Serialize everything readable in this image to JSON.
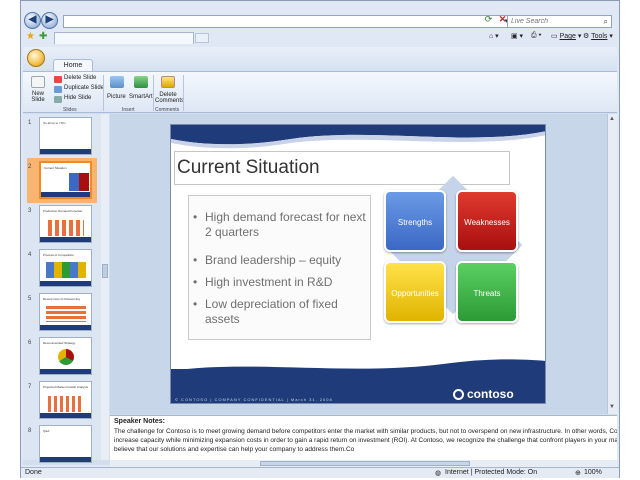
{
  "browser": {
    "search_placeholder": "Live Search",
    "commands": {
      "page": "Page",
      "tools": "Tools"
    }
  },
  "ribbon": {
    "tab_home": "Home",
    "new_slide": "New Slide",
    "delete_slide": "Delete Slide",
    "duplicate_slide": "Duplicate Slide",
    "hide_slide": "Hide Slide",
    "group_slides": "Slides",
    "picture": "Picture",
    "smartart": "SmartArt",
    "group_insert": "Insert",
    "delete_comments": "Delete Comments",
    "group_comments": "Comments"
  },
  "thumbnails": [
    {
      "num": "1",
      "title": "It's all up to YOU"
    },
    {
      "num": "2",
      "title": "Current Situation"
    },
    {
      "num": "3",
      "title": "Production Demand Forecast"
    },
    {
      "num": "4",
      "title": "Process of Competition"
    },
    {
      "num": "5",
      "title": "Recent Cost of Outsourcing"
    },
    {
      "num": "6",
      "title": "Recommended Strategy"
    },
    {
      "num": "7",
      "title": "Projected Market Growth Analysis"
    },
    {
      "num": "8",
      "title": "Q&A"
    }
  ],
  "slide": {
    "title": "Current Situation",
    "bullets": [
      "High demand forecast for next 2 quarters",
      "Brand leadership – equity",
      "High investment in R&D",
      "Low depreciation of fixed assets"
    ],
    "swot": {
      "strengths": "Strengths",
      "weaknesses": "Weaknesses",
      "opportunities": "Opportunities",
      "threats": "Threats"
    },
    "footer": "© CONTOSO  |  COMPANY CONFIDENTIAL  |  March 31, 2008",
    "logo": "contoso"
  },
  "notes": {
    "title": "Speaker Notes:",
    "body": "The challenge for Contoso is to meet growing demand before competitors enter the market with similar products, but not to overspend on new infrastructure. In other words, Contoso must increase capacity while minimizing expansion costs in order to gain a rapid return on investment (ROI). At Contoso, we recognize the challenge that confront players in your market and believe that our solutions and expertise can help your company to address them.Co"
  },
  "status": {
    "left": "Done",
    "zone": "Internet | Protected Mode: On",
    "zoom": "100%"
  },
  "colors": {
    "slide_navy": "#1f3b7a",
    "strengths": "#3b68c4",
    "weaknesses": "#a80f0f",
    "opportunities": "#e0b400",
    "threats": "#2c9a35",
    "selected_thumb": "#f08a24"
  }
}
